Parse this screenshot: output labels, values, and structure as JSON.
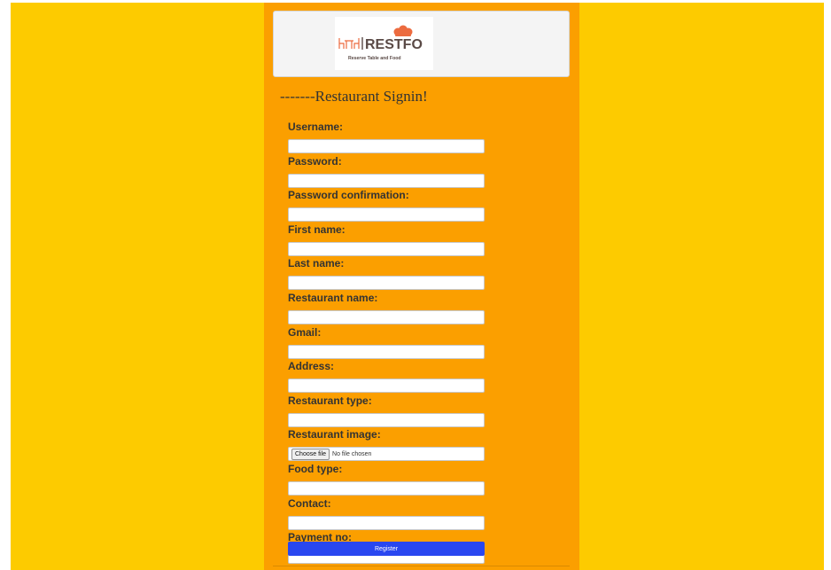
{
  "brand": {
    "name": "RESTFO",
    "tagline": "Reserve Table and Food"
  },
  "form": {
    "heading": "-------Restaurant Signin!",
    "fields": [
      {
        "label": "Username:",
        "value": ""
      },
      {
        "label": "Password:",
        "value": ""
      },
      {
        "label": "Password confirmation:",
        "value": ""
      },
      {
        "label": "First name:",
        "value": ""
      },
      {
        "label": "Last name:",
        "value": ""
      },
      {
        "label": "Restaurant name:",
        "value": ""
      },
      {
        "label": "Gmail:",
        "value": ""
      },
      {
        "label": "Address:",
        "value": ""
      },
      {
        "label": "Restaurant type:",
        "value": ""
      },
      {
        "label": "Restaurant image:",
        "button": "Choose file",
        "status": "No file chosen"
      },
      {
        "label": "Food type:",
        "value": ""
      },
      {
        "label": "Contact:",
        "value": ""
      },
      {
        "label": "Payment no:",
        "value": ""
      }
    ],
    "submit_label": "Register"
  },
  "colors": {
    "page_background": "#fdcb00",
    "card_background": "#fb9f00",
    "header_background": "#f4f4f4",
    "button_background": "#2947f0",
    "logo_accent": "#ec6b3f"
  }
}
